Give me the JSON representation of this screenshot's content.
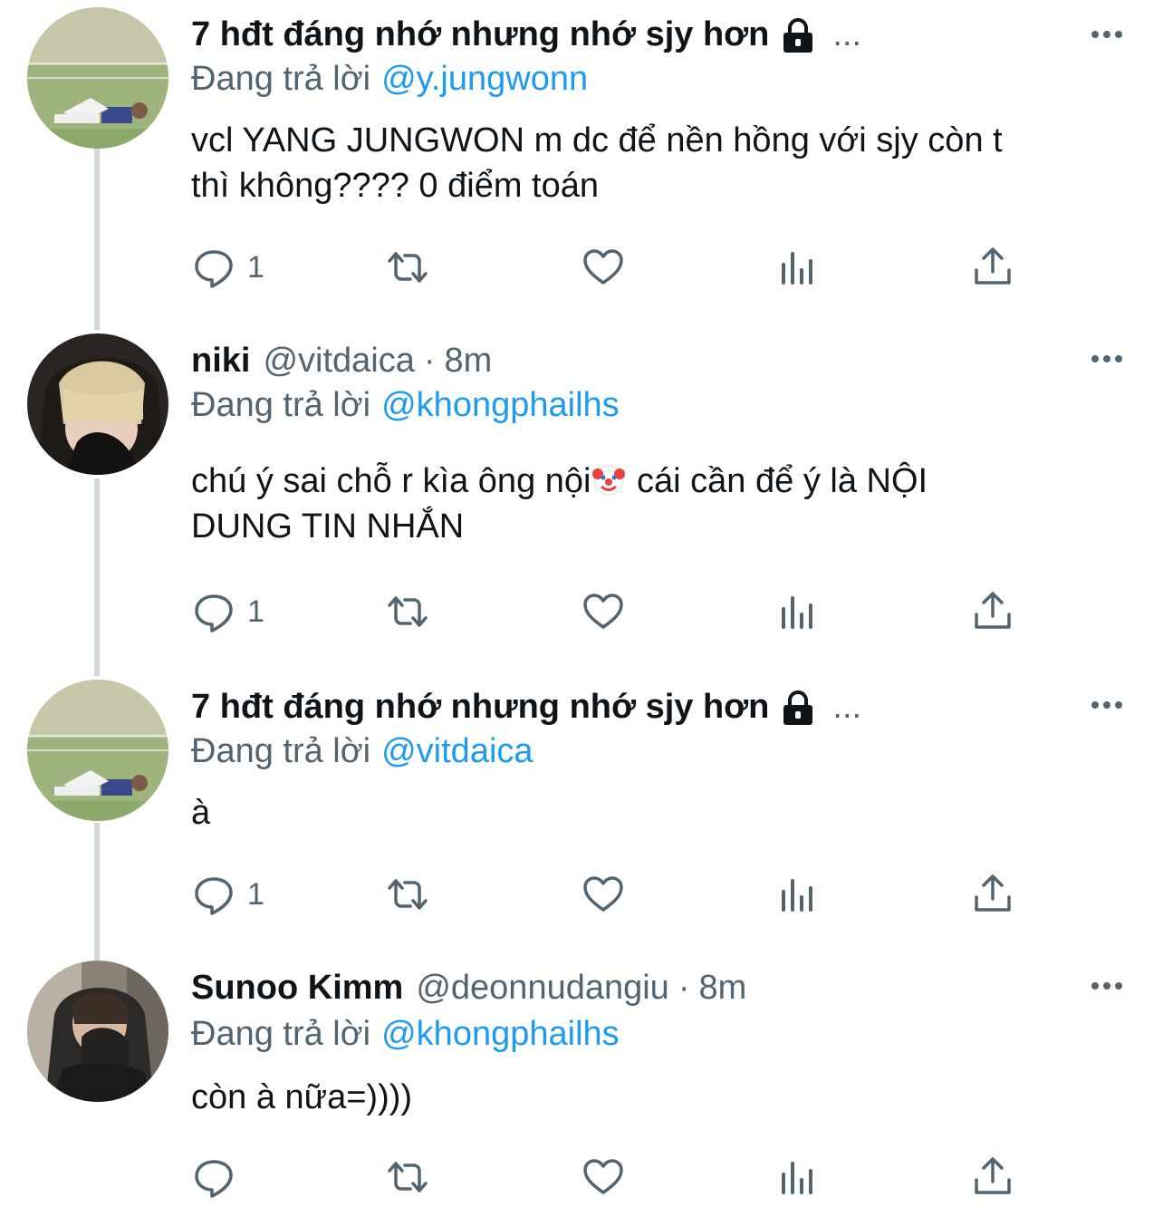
{
  "tweets": [
    {
      "name": "7 hđt đáng nhớ nhưng nhớ sjy hơn",
      "handle": "",
      "time": "",
      "truncated": "...",
      "locked": true,
      "reply_prefix": "Đang trả lời",
      "reply_to": "@y.jungwonn",
      "text_lines": [
        "vcl YANG JUNGWON m dc để nền hồng với sjy còn t",
        "thì không???? 0 điểm toán"
      ],
      "reply_count": "1",
      "avatar": "field-photo-avatar"
    },
    {
      "name": "niki",
      "handle": "@vitdaica",
      "separator": "·",
      "time": "8m",
      "reply_prefix": "Đang trả lời",
      "reply_to": "@khongphailhs",
      "text_lines": [
        "chú ý sai chỗ r kìa ông nội",
        " cái cần để ý là NỘI",
        "DUNG TIN NHẮN"
      ],
      "emoji": "clown-face-emoji",
      "reply_count": "1",
      "avatar": "blond-person-avatar"
    },
    {
      "name": "7 hđt đáng nhớ nhưng nhớ sjy hơn",
      "truncated": "...",
      "locked": true,
      "reply_prefix": "Đang trả lời",
      "reply_to": "@vitdaica",
      "text_lines": [
        "à"
      ],
      "reply_count": "1",
      "avatar": "field-photo-avatar"
    },
    {
      "name": "Sunoo Kimm",
      "handle": "@deonnudangiu",
      "separator": "·",
      "time": "8m",
      "reply_prefix": "Đang trả lời",
      "reply_to": "@khongphailhs",
      "text_lines": [
        "còn à nữa=))))"
      ],
      "reply_count": "",
      "avatar": "person-hoodie-avatar"
    }
  ],
  "icons": {
    "reply": "reply-icon",
    "retweet": "retweet-icon",
    "like": "like-icon",
    "analytics": "analytics-icon",
    "share": "share-icon",
    "more": "more-icon",
    "lock": "lock-icon"
  },
  "colors": {
    "link": "#1d9bf0",
    "secondary_text": "#536471",
    "primary_text": "#0f1419",
    "thread_line": "#cfd9de"
  }
}
